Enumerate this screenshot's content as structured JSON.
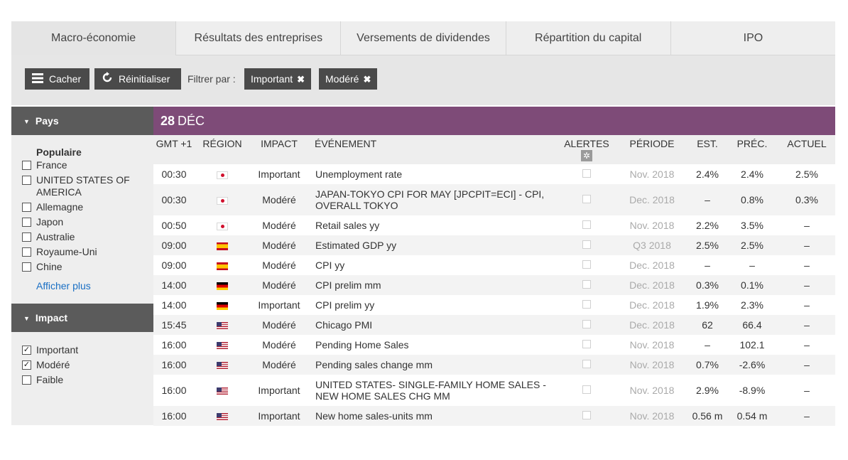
{
  "tabs": [
    {
      "label": "Macro-économie",
      "active": true
    },
    {
      "label": "Résultats des entreprises",
      "active": false
    },
    {
      "label": "Versements de dividendes",
      "active": false
    },
    {
      "label": "Répartition du capital",
      "active": false
    },
    {
      "label": "IPO",
      "active": false
    }
  ],
  "toolbar": {
    "hide_label": "Cacher",
    "reset_label": "Réinitialiser",
    "filter_label": "Filtrer par :",
    "chips": [
      "Important",
      "Modéré"
    ]
  },
  "sidebar": {
    "country_header": "Pays",
    "popular_label": "Populaire",
    "countries": [
      {
        "label": "France",
        "checked": false
      },
      {
        "label": "UNITED STATES OF AMERICA",
        "checked": false
      },
      {
        "label": "Allemagne",
        "checked": false
      },
      {
        "label": "Japon",
        "checked": false
      },
      {
        "label": "Australie",
        "checked": false
      },
      {
        "label": "Royaume-Uni",
        "checked": false
      },
      {
        "label": "Chine",
        "checked": false
      }
    ],
    "show_more": "Afficher plus",
    "impact_header": "Impact",
    "impacts": [
      {
        "label": "Important",
        "checked": true
      },
      {
        "label": "Modéré",
        "checked": true
      },
      {
        "label": "Faible",
        "checked": false
      }
    ]
  },
  "calendar": {
    "date_day": "28",
    "date_month": "DÉC",
    "columns": {
      "time": "GMT +1",
      "region": "RÉGION",
      "impact": "IMPACT",
      "event": "ÉVÉNEMENT",
      "alerts": "ALERTES",
      "period": "PÉRIODE",
      "est": "EST.",
      "prev": "PRÉC.",
      "actual": "ACTUEL"
    },
    "rows": [
      {
        "time": "00:30",
        "flag": "jp",
        "impact": "Important",
        "event": "Unemployment rate",
        "period": "Nov. 2018",
        "est": "2.4%",
        "prev": "2.4%",
        "actual": "2.5%"
      },
      {
        "time": "00:30",
        "flag": "jp",
        "impact": "Modéré",
        "event": "JAPAN-TOKYO CPI FOR MAY [JPCPIT=ECI] - CPI, OVERALL TOKYO",
        "period": "Dec. 2018",
        "est": "–",
        "prev": "0.8%",
        "actual": "0.3%"
      },
      {
        "time": "00:50",
        "flag": "jp",
        "impact": "Modéré",
        "event": "Retail sales yy",
        "period": "Nov. 2018",
        "est": "2.2%",
        "prev": "3.5%",
        "actual": "–"
      },
      {
        "time": "09:00",
        "flag": "es",
        "impact": "Modéré",
        "event": "Estimated GDP yy",
        "period": "Q3 2018",
        "est": "2.5%",
        "prev": "2.5%",
        "actual": "–"
      },
      {
        "time": "09:00",
        "flag": "es",
        "impact": "Modéré",
        "event": "CPI yy",
        "period": "Dec. 2018",
        "est": "–",
        "prev": "–",
        "actual": "–"
      },
      {
        "time": "14:00",
        "flag": "de",
        "impact": "Modéré",
        "event": "CPI prelim mm",
        "period": "Dec. 2018",
        "est": "0.3%",
        "prev": "0.1%",
        "actual": "–"
      },
      {
        "time": "14:00",
        "flag": "de",
        "impact": "Important",
        "event": "CPI prelim yy",
        "period": "Dec. 2018",
        "est": "1.9%",
        "prev": "2.3%",
        "actual": "–"
      },
      {
        "time": "15:45",
        "flag": "us",
        "impact": "Modéré",
        "event": "Chicago PMI",
        "period": "Dec. 2018",
        "est": "62",
        "prev": "66.4",
        "actual": "–"
      },
      {
        "time": "16:00",
        "flag": "us",
        "impact": "Modéré",
        "event": "Pending Home Sales",
        "period": "Nov. 2018",
        "est": "–",
        "prev": "102.1",
        "actual": "–"
      },
      {
        "time": "16:00",
        "flag": "us",
        "impact": "Modéré",
        "event": "Pending sales change mm",
        "period": "Nov. 2018",
        "est": "0.7%",
        "prev": "-2.6%",
        "actual": "–"
      },
      {
        "time": "16:00",
        "flag": "us",
        "impact": "Important",
        "event": "UNITED STATES- SINGLE-FAMILY HOME SALES - NEW HOME SALES CHG MM",
        "period": "Nov. 2018",
        "est": "2.9%",
        "prev": "-8.9%",
        "actual": "–"
      },
      {
        "time": "16:00",
        "flag": "us",
        "impact": "Important",
        "event": "New home sales-units mm",
        "period": "Nov. 2018",
        "est": "0.56 m",
        "prev": "0.54 m",
        "actual": "–"
      }
    ]
  },
  "colors": {
    "date_bar": "#7e4b78",
    "dark_button": "#4a4a4a",
    "sidebar_header": "#5b5b5b",
    "link": "#1a6fc4"
  }
}
